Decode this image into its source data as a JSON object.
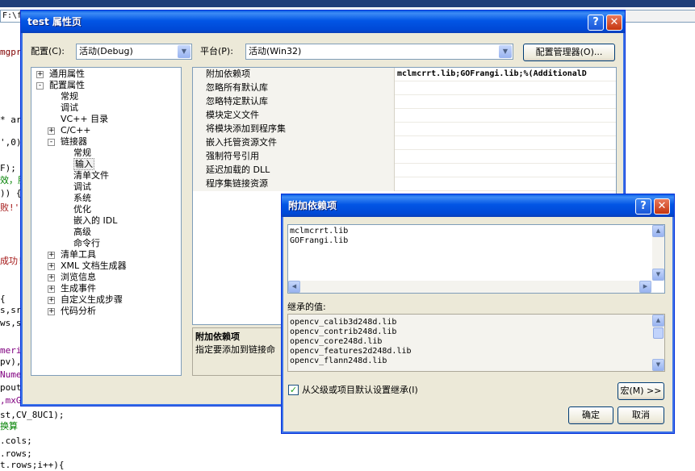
{
  "editor": {
    "path_text": "F:\\f",
    "code_lines": [
      {
        "text": "mgpr",
        "color": "#800000"
      },
      {
        "text": "* ar",
        "color": "#000000"
      },
      {
        "text": "',0)",
        "color": "#000000"
      },
      {
        "text": "F);",
        "color": "#000000"
      },
      {
        "text": "效，服",
        "color": "#008000"
      },
      {
        "text": ")) {",
        "color": "#000000"
      },
      {
        "text": "败!'",
        "color": "#a31515"
      },
      {
        "text": "成功!'",
        "color": "#a31515"
      },
      {
        "text": "{",
        "color": "#000000"
      },
      {
        "text": "s,sr",
        "color": "#000000"
      },
      {
        "text": "ws,s",
        "color": "#000000"
      },
      {
        "text": "meri",
        "color": "#800080"
      },
      {
        "text": "pv),",
        "color": "#000000"
      },
      {
        "text": "Nume",
        "color": "#800080"
      },
      {
        "text": "pout",
        "color": "#000000"
      },
      {
        "text": ",mxG",
        "color": "#800080"
      },
      {
        "text": "st,CV_8UC1);",
        "color": "#000000"
      },
      {
        "text": "换算",
        "color": "#008000"
      },
      {
        "text": ".cols;",
        "color": "#000000"
      },
      {
        "text": ".rows;",
        "color": "#000000"
      },
      {
        "text": "t.rows;i++){",
        "color": "#000000"
      }
    ]
  },
  "props_dialog": {
    "title": "test 属性页",
    "help_glyph": "?",
    "close_glyph": "✕",
    "config_label": "配置(C):",
    "config_value": "活动(Debug)",
    "platform_label": "平台(P):",
    "platform_value": "活动(Win32)",
    "config_manager_button": "配置管理器(O)...",
    "tree": [
      {
        "label": "通用属性",
        "level": 0,
        "expander": "+"
      },
      {
        "label": "配置属性",
        "level": 0,
        "expander": "-"
      },
      {
        "label": "常规",
        "level": 1,
        "expander": ""
      },
      {
        "label": "调试",
        "level": 1,
        "expander": ""
      },
      {
        "label": "VC++ 目录",
        "level": 1,
        "expander": ""
      },
      {
        "label": "C/C++",
        "level": 1,
        "expander": "+"
      },
      {
        "label": "链接器",
        "level": 1,
        "expander": "-"
      },
      {
        "label": "常规",
        "level": 2,
        "expander": ""
      },
      {
        "label": "输入",
        "level": 2,
        "expander": "",
        "selected": true
      },
      {
        "label": "清单文件",
        "level": 2,
        "expander": ""
      },
      {
        "label": "调试",
        "level": 2,
        "expander": ""
      },
      {
        "label": "系统",
        "level": 2,
        "expander": ""
      },
      {
        "label": "优化",
        "level": 2,
        "expander": ""
      },
      {
        "label": "嵌入的 IDL",
        "level": 2,
        "expander": ""
      },
      {
        "label": "高级",
        "level": 2,
        "expander": ""
      },
      {
        "label": "命令行",
        "level": 2,
        "expander": ""
      },
      {
        "label": "清单工具",
        "level": 1,
        "expander": "+"
      },
      {
        "label": "XML 文档生成器",
        "level": 1,
        "expander": "+"
      },
      {
        "label": "浏览信息",
        "level": 1,
        "expander": "+"
      },
      {
        "label": "生成事件",
        "level": 1,
        "expander": "+"
      },
      {
        "label": "自定义生成步骤",
        "level": 1,
        "expander": "+"
      },
      {
        "label": "代码分析",
        "level": 1,
        "expander": "+"
      }
    ],
    "grid_rows": [
      {
        "name": "附加依赖项",
        "value": "mclmcrrt.lib;GOFrangi.lib;%(AdditionalD"
      },
      {
        "name": "忽略所有默认库",
        "value": ""
      },
      {
        "name": "忽略特定默认库",
        "value": ""
      },
      {
        "name": "模块定义文件",
        "value": ""
      },
      {
        "name": "将模块添加到程序集",
        "value": ""
      },
      {
        "name": "嵌入托管资源文件",
        "value": ""
      },
      {
        "name": "强制符号引用",
        "value": ""
      },
      {
        "name": "延迟加载的 DLL",
        "value": ""
      },
      {
        "name": "程序集链接资源",
        "value": ""
      }
    ],
    "description_title": "附加依赖项",
    "description_text": "指定要添加到链接命"
  },
  "dep_dialog": {
    "title": "附加依赖项",
    "help_glyph": "?",
    "close_glyph": "✕",
    "edit_lines": [
      "mclmcrrt.lib",
      "GOFrangi.lib"
    ],
    "inherited_label": "继承的值:",
    "inherited_lines": [
      "opencv_calib3d248d.lib",
      "opencv_contrib248d.lib",
      "opencv_core248d.lib",
      "opencv_features2d248d.lib",
      "opencv_flann248d.lib"
    ],
    "inherit_checkbox_label": "从父级或项目默认设置继承(I)",
    "inherit_checked": true,
    "macro_button": "宏(M) >>",
    "ok_button": "确定",
    "cancel_button": "取消"
  }
}
